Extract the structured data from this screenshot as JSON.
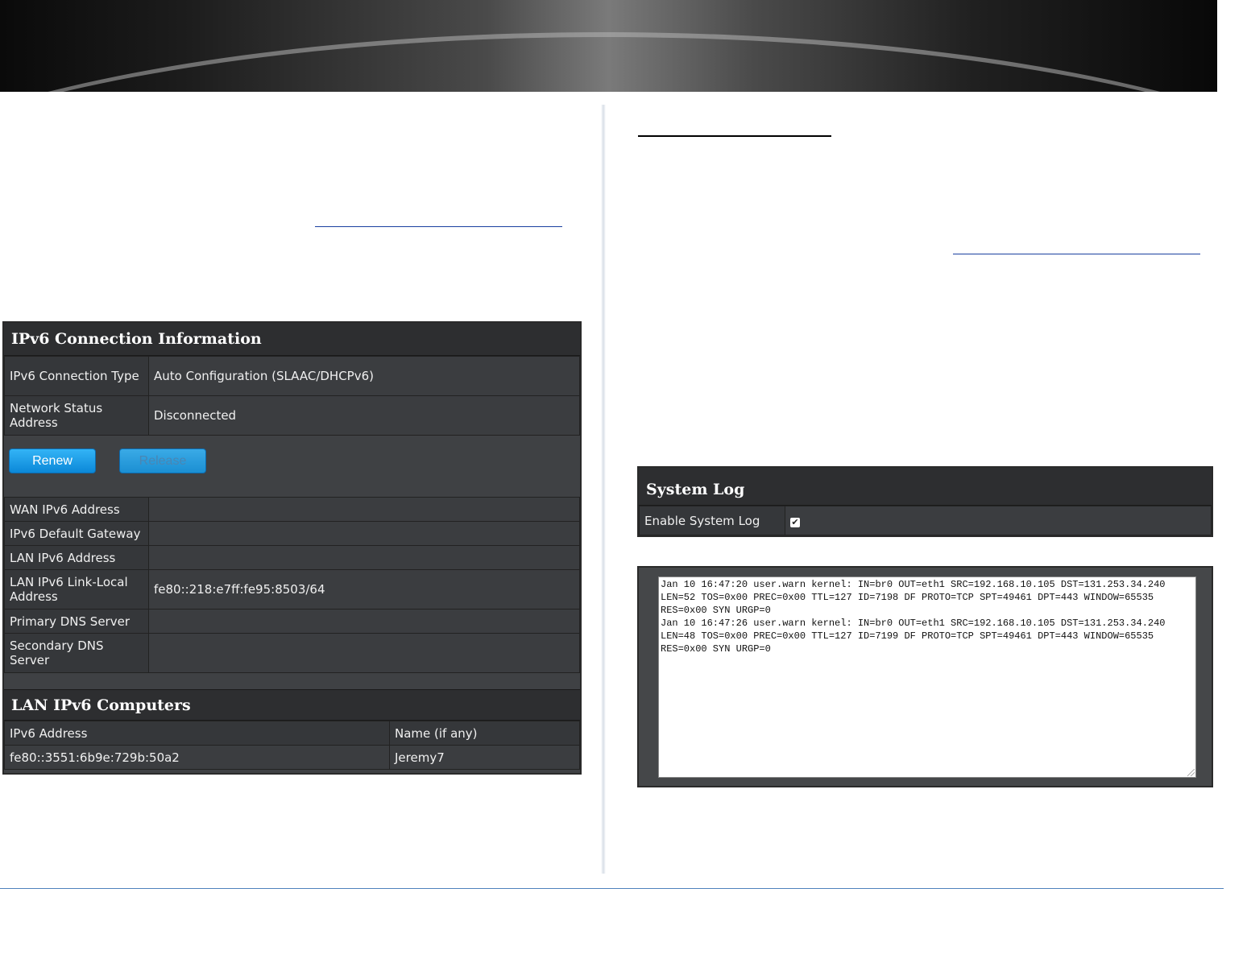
{
  "ipv6_info": {
    "title": "IPv6 Connection Information",
    "rows_top": [
      {
        "label": "IPv6 Connection Type",
        "value": "Auto Configuration (SLAAC/DHCPv6)"
      },
      {
        "label": "Network Status Address",
        "value": "Disconnected"
      }
    ],
    "buttons": {
      "renew": "Renew",
      "release": "Release"
    },
    "rows_bottom": [
      {
        "label": "WAN IPv6 Address",
        "value": ""
      },
      {
        "label": "IPv6 Default Gateway",
        "value": ""
      },
      {
        "label": "LAN IPv6 Address",
        "value": ""
      },
      {
        "label": "LAN IPv6 Link-Local Address",
        "value": "fe80::218:e7ff:fe95:8503/64"
      },
      {
        "label": "Primary DNS Server",
        "value": ""
      },
      {
        "label": "Secondary DNS Server",
        "value": ""
      }
    ]
  },
  "lan_computers": {
    "title": "LAN IPv6 Computers",
    "headers": [
      "IPv6 Address",
      "Name (if any)"
    ],
    "rows": [
      {
        "address": "fe80::3551:6b9e:729b:50a2",
        "name": "Jeremy7"
      }
    ]
  },
  "system_log": {
    "title": "System Log",
    "enable_label": "Enable System Log",
    "enabled": true,
    "checkmark": "✔",
    "log_lines": [
      "Jan 10 16:47:20 user.warn kernel: IN=br0 OUT=eth1 SRC=192.168.10.105 DST=131.253.34.240",
      "LEN=52 TOS=0x00 PREC=0x00 TTL=127 ID=7198 DF PROTO=TCP SPT=49461 DPT=443 WINDOW=65535",
      "RES=0x00 SYN URGP=0",
      "Jan 10 16:47:26 user.warn kernel: IN=br0 OUT=eth1 SRC=192.168.10.105 DST=131.253.34.240",
      "LEN=48 TOS=0x00 PREC=0x00 TTL=127 ID=7199 DF PROTO=TCP SPT=49461 DPT=443 WINDOW=65535",
      "RES=0x00 SYN URGP=0"
    ]
  }
}
